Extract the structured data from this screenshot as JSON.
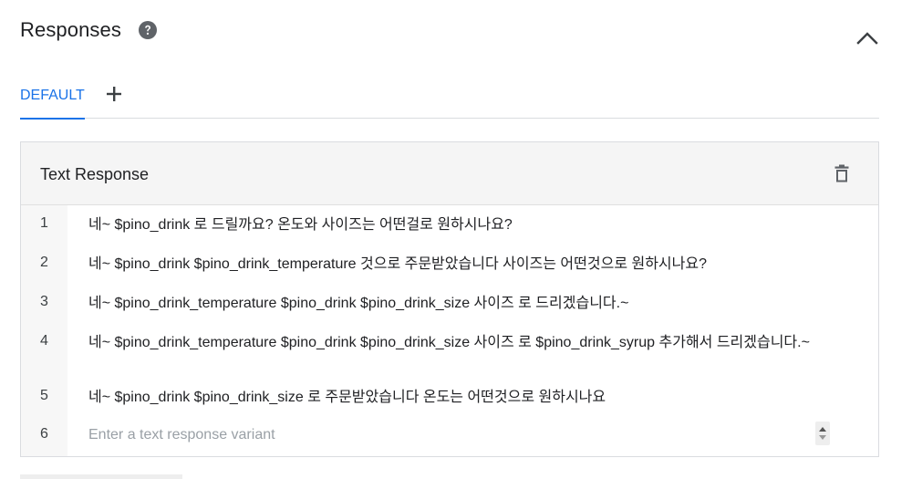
{
  "header": {
    "title": "Responses",
    "help_icon": "help-circle-icon",
    "collapse_icon": "chevron-up-icon"
  },
  "tabs": {
    "active_label": "DEFAULT",
    "add_icon": "plus-icon"
  },
  "card": {
    "title": "Text Response",
    "delete_icon": "trash-icon",
    "rows": [
      {
        "num": "1",
        "text": "네~ $pino_drink  로 드릴까요? 온도와 사이즈는 어떤걸로 원하시나요?"
      },
      {
        "num": "2",
        "text": "네~ $pino_drink  $pino_drink_temperature 것으로 주문받았습니다 사이즈는 어떤것으로 원하시나요?"
      },
      {
        "num": "3",
        "text": "네~ $pino_drink_temperature $pino_drink    $pino_drink_size 사이즈 로 드리겠습니다.~"
      },
      {
        "num": "4",
        "text": "네~  $pino_drink_temperature  $pino_drink  $pino_drink_size 사이즈 로  $pino_drink_syrup 추가해서 드리겠습니다.~"
      },
      {
        "num": "5",
        "text": "네~ $pino_drink  $pino_drink_size 로 주문받았습니다 온도는 어떤것으로 원하시나요"
      }
    ],
    "new_row": {
      "num": "6",
      "value": "",
      "placeholder": "Enter a text response variant"
    }
  },
  "colors": {
    "accent": "#1a73e8",
    "text": "#202124",
    "muted": "#9aa0a6",
    "header_bg": "#f5f5f5",
    "gutter_bg": "#f7f7f7"
  }
}
